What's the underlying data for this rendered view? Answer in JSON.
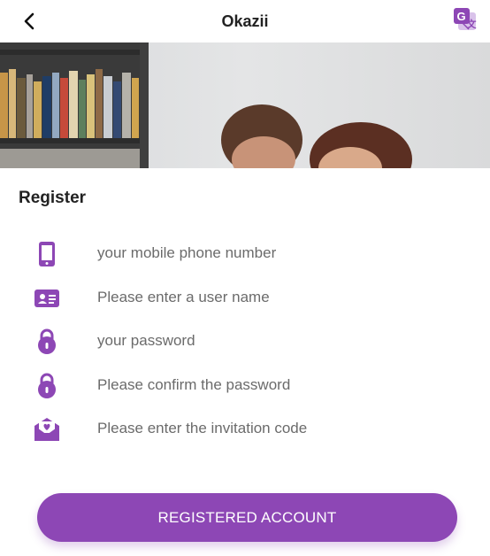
{
  "header": {
    "title": "Okazii",
    "back_icon": "chevron-left-icon",
    "translate_icon": "google-translate-icon"
  },
  "banner": {
    "image": "photo of two people in front of a bookshelf"
  },
  "register": {
    "title": "Register",
    "fields": [
      {
        "icon": "smartphone-icon",
        "placeholder": "your mobile phone number",
        "value": ""
      },
      {
        "icon": "id-card-icon",
        "placeholder": "Please enter a user name",
        "value": ""
      },
      {
        "icon": "lock-icon",
        "placeholder": "your password",
        "value": ""
      },
      {
        "icon": "lock-icon",
        "placeholder": "Please confirm the password",
        "value": ""
      },
      {
        "icon": "envelope-heart-icon",
        "placeholder": "Please enter the invitation code",
        "value": ""
      }
    ],
    "submit_label": "REGISTERED ACCOUNT"
  },
  "colors": {
    "accent": "#8d47b5",
    "accent_light": "#9b59c0",
    "background": "#ffffff",
    "text_dark": "#222222",
    "placeholder": "#6b6b6b"
  }
}
